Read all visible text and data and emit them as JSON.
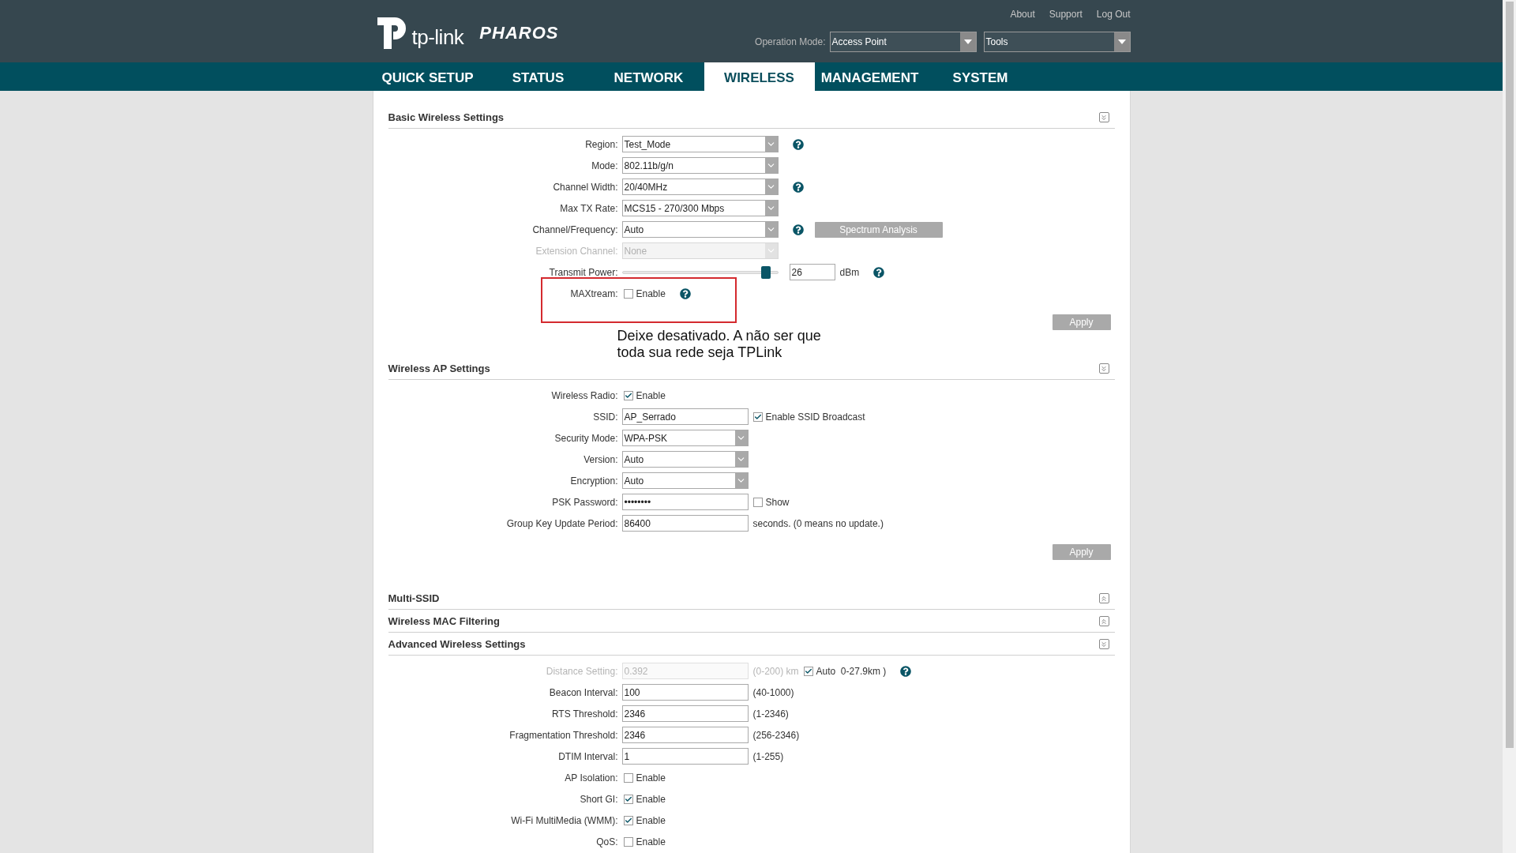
{
  "header": {
    "logo_text": "tp-link",
    "product": "PHAROS",
    "links": [
      "About",
      "Support",
      "Log Out"
    ],
    "operation_mode": {
      "label": "Operation Mode:",
      "value": "Access Point"
    },
    "tools": {
      "value": "Tools"
    }
  },
  "nav": [
    {
      "label": "QUICK SETUP",
      "selected": false
    },
    {
      "label": "STATUS",
      "selected": false
    },
    {
      "label": "NETWORK",
      "selected": false
    },
    {
      "label": "WIRELESS",
      "selected": true
    },
    {
      "label": "MANAGEMENT",
      "selected": false
    },
    {
      "label": "SYSTEM",
      "selected": false
    }
  ],
  "sections": [
    {
      "title": "Basic Wireless Settings",
      "expanded": true,
      "apply": "Apply",
      "rows": [
        {
          "label": "Region:",
          "disabled": false,
          "controls": [
            {
              "kind": "select",
              "value": "Test_Mode"
            },
            {
              "kind": "help"
            }
          ]
        },
        {
          "label": "Mode:",
          "disabled": false,
          "controls": [
            {
              "kind": "select",
              "value": "802.11b/g/n"
            }
          ]
        },
        {
          "label": "Channel Width:",
          "disabled": false,
          "controls": [
            {
              "kind": "select",
              "value": "20/40MHz"
            },
            {
              "kind": "help"
            }
          ]
        },
        {
          "label": "Max TX Rate:",
          "disabled": false,
          "controls": [
            {
              "kind": "select",
              "value": "MCS15 - 270/300 Mbps"
            }
          ]
        },
        {
          "label": "Channel/Frequency:",
          "disabled": false,
          "controls": [
            {
              "kind": "select",
              "value": "Auto"
            },
            {
              "kind": "help"
            },
            {
              "kind": "button",
              "text": "Spectrum Analysis"
            }
          ]
        },
        {
          "label": "Extension Channel:",
          "disabled": true,
          "controls": [
            {
              "kind": "select",
              "value": "None"
            }
          ]
        },
        {
          "label": "Transmit Power:",
          "disabled": false,
          "controls": [
            {
              "kind": "slider",
              "level": 0.95
            },
            {
              "kind": "short-input",
              "value": "26"
            },
            {
              "kind": "text",
              "text": "dBm",
              "disabled": false
            },
            {
              "kind": "help"
            }
          ]
        },
        {
          "label": "MAXtream:",
          "disabled": false,
          "controls": [
            {
              "kind": "checkbox",
              "checked": false,
              "text": "Enable"
            },
            {
              "kind": "help"
            }
          ]
        }
      ]
    },
    {
      "title": "Wireless AP Settings",
      "expanded": true,
      "apply": "Apply",
      "rows": [
        {
          "label": "Wireless Radio:",
          "disabled": false,
          "controls": [
            {
              "kind": "checkbox",
              "checked": true,
              "text": "Enable"
            }
          ]
        },
        {
          "label": "SSID:",
          "disabled": false,
          "controls": [
            {
              "kind": "input",
              "value": "AP_Serrado"
            },
            {
              "kind": "checkbox",
              "checked": true,
              "text": "Enable SSID Broadcast"
            }
          ]
        },
        {
          "label": "Security Mode:",
          "disabled": false,
          "controls": [
            {
              "kind": "short-select",
              "value": "WPA-PSK"
            }
          ]
        },
        {
          "label": "Version:",
          "disabled": false,
          "controls": [
            {
              "kind": "short-select",
              "value": "Auto"
            }
          ]
        },
        {
          "label": "Encryption:",
          "disabled": false,
          "controls": [
            {
              "kind": "short-select",
              "value": "Auto"
            }
          ]
        },
        {
          "label": "PSK Password:",
          "disabled": false,
          "controls": [
            {
              "kind": "input",
              "value": "••••••••"
            },
            {
              "kind": "checkbox",
              "checked": false,
              "text": "Show"
            }
          ]
        },
        {
          "label": "Group Key Update Period:",
          "disabled": false,
          "controls": [
            {
              "kind": "input",
              "value": "86400"
            },
            {
              "kind": "text",
              "text": "seconds. (0 means no update.)",
              "disabled": false
            }
          ]
        }
      ]
    },
    {
      "title": "Multi-SSID",
      "expanded": false
    },
    {
      "title": "Wireless MAC Filtering",
      "expanded": false
    },
    {
      "title": "Advanced Wireless Settings",
      "expanded": true,
      "rows": [
        {
          "label": "Distance Setting:",
          "disabled": true,
          "controls": [
            {
              "kind": "input",
              "value": "0.392"
            },
            {
              "kind": "text",
              "text": "(0-200) km",
              "disabled": true
            },
            {
              "kind": "checkbox",
              "checked": true,
              "text": "Auto  0-27.9km )"
            },
            {
              "kind": "help"
            }
          ]
        },
        {
          "label": "Beacon Interval:",
          "disabled": false,
          "controls": [
            {
              "kind": "input",
              "value": "100"
            },
            {
              "kind": "text",
              "text": "(40-1000)",
              "disabled": false
            }
          ]
        },
        {
          "label": "RTS Threshold:",
          "disabled": false,
          "controls": [
            {
              "kind": "input",
              "value": "2346"
            },
            {
              "kind": "text",
              "text": "(1-2346)",
              "disabled": false
            }
          ]
        },
        {
          "label": "Fragmentation Threshold:",
          "disabled": false,
          "controls": [
            {
              "kind": "input",
              "value": "2346"
            },
            {
              "kind": "text",
              "text": "(256-2346)",
              "disabled": false
            }
          ]
        },
        {
          "label": "DTIM Interval:",
          "disabled": false,
          "controls": [
            {
              "kind": "input",
              "value": "1"
            },
            {
              "kind": "text",
              "text": "(1-255)",
              "disabled": false
            }
          ]
        },
        {
          "label": "AP Isolation:",
          "disabled": false,
          "controls": [
            {
              "kind": "checkbox",
              "checked": false,
              "text": "Enable"
            }
          ]
        },
        {
          "label": "Short GI:",
          "disabled": false,
          "controls": [
            {
              "kind": "checkbox",
              "checked": true,
              "text": "Enable"
            }
          ]
        },
        {
          "label": "Wi-Fi MultiMedia (WMM):",
          "disabled": false,
          "controls": [
            {
              "kind": "checkbox",
              "checked": true,
              "text": "Enable"
            }
          ]
        },
        {
          "label": "QoS:",
          "disabled": false,
          "controls": [
            {
              "kind": "checkbox",
              "checked": false,
              "text": "Enable"
            }
          ]
        }
      ]
    }
  ],
  "annotation": {
    "lines": [
      "Deixe desativado. A não ser que",
      "toda sua rede seja TPLink"
    ]
  }
}
